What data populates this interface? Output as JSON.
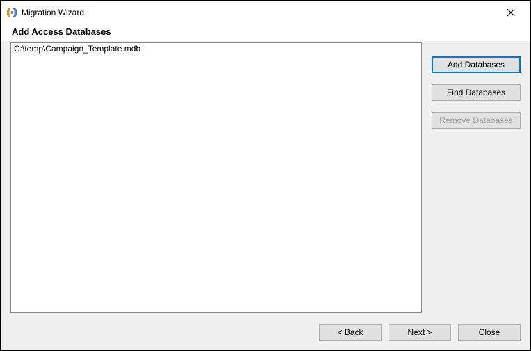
{
  "window": {
    "title": "Migration Wizard"
  },
  "header": {
    "title": "Add Access Databases"
  },
  "list": {
    "items": [
      "C:\\temp\\Campaign_Template.mdb"
    ]
  },
  "sideButtons": {
    "add": "Add Databases",
    "find": "Find Databases",
    "remove": "Remove Databases"
  },
  "footer": {
    "back": "< Back",
    "next": "Next >",
    "close": "Close"
  }
}
